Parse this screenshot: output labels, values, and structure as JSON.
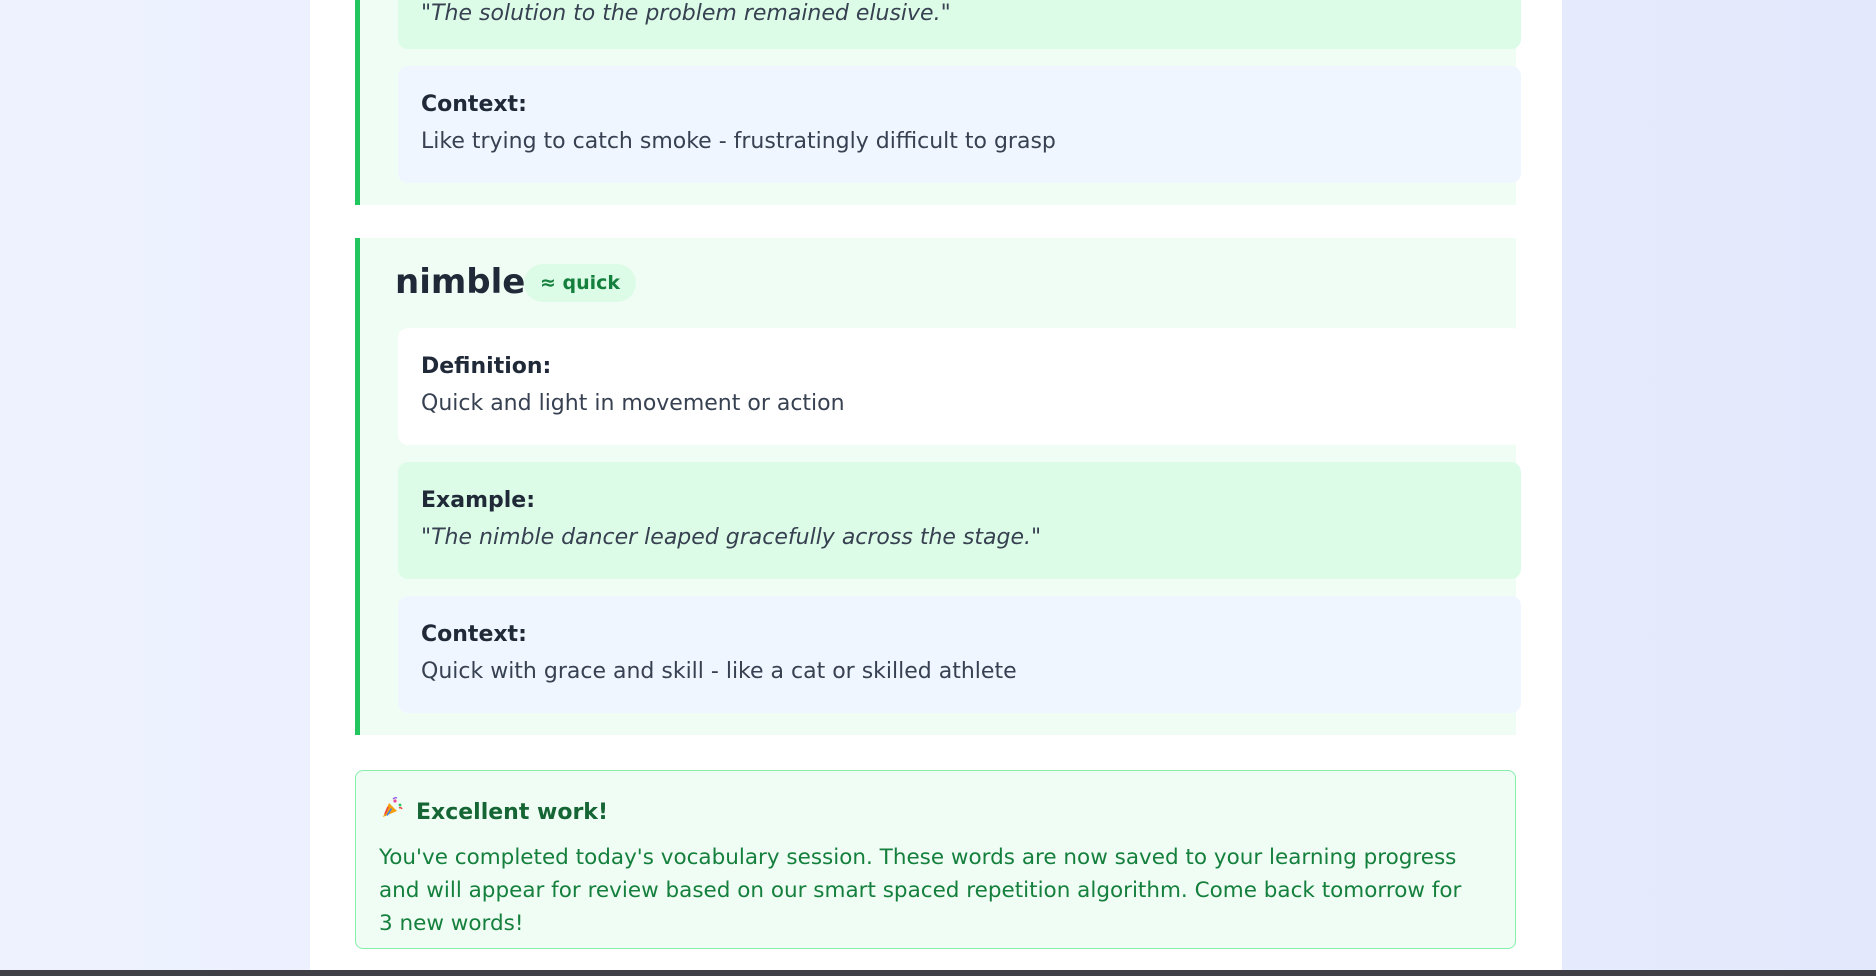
{
  "previous_word": {
    "example_text": "\"The solution to the problem remained elusive.\"",
    "context_label": "Context:",
    "context_text": "Like trying to catch smoke - frustratingly difficult to grasp"
  },
  "current_word": {
    "word": "nimble",
    "synonym_badge": "≈ quick",
    "definition_label": "Definition:",
    "definition_text": "Quick and light in movement or action",
    "example_label": "Example:",
    "example_text": "\"The nimble dancer leaped gracefully across the stage.\"",
    "context_label": "Context:",
    "context_text": "Quick with grace and skill - like a cat or skilled athlete"
  },
  "completion": {
    "icon": "party-popper-icon",
    "title": "Excellent work!",
    "message": "You've completed today's vocabulary session. These words are now saved to your learning progress and will appear for review based on our smart spaced repetition algorithm. Come back tomorrow for 3 new words!"
  },
  "colors": {
    "accent_green": "#22c55e",
    "card_bg": "#f0fdf4",
    "example_bg": "#dcfce7",
    "context_bg": "#eff6ff",
    "success_text": "#15803d"
  }
}
